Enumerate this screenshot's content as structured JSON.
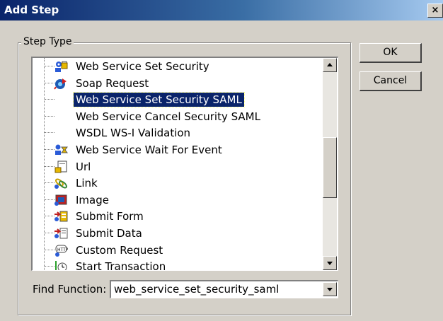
{
  "window": {
    "title": "Add Step",
    "close_glyph": "×"
  },
  "group": {
    "legend": "Step Type"
  },
  "step_list": {
    "items": [
      {
        "label": "Web Service Set Security",
        "icon": "web-service-security-icon",
        "selected": false
      },
      {
        "label": "Soap Request",
        "icon": "soap-request-icon",
        "selected": false
      },
      {
        "label": "Web Service Set Security SAML",
        "icon": "",
        "selected": true
      },
      {
        "label": "Web Service Cancel Security SAML",
        "icon": "",
        "selected": false
      },
      {
        "label": "WSDL WS-I Validation",
        "icon": "",
        "selected": false
      },
      {
        "label": "Web Service Wait For Event",
        "icon": "wait-for-event-icon",
        "selected": false
      },
      {
        "label": "Url",
        "icon": "url-icon",
        "selected": false
      },
      {
        "label": "Link",
        "icon": "link-icon",
        "selected": false
      },
      {
        "label": "Image",
        "icon": "image-icon",
        "selected": false
      },
      {
        "label": "Submit Form",
        "icon": "submit-form-icon",
        "selected": false
      },
      {
        "label": "Submit Data",
        "icon": "submit-data-icon",
        "selected": false
      },
      {
        "label": "Custom Request",
        "icon": "custom-request-icon",
        "selected": false
      },
      {
        "label": "Start Transaction",
        "icon": "start-transaction-icon",
        "selected": false
      }
    ],
    "scroll_position": 0.4
  },
  "find": {
    "label": "Find Function:",
    "value": "web_service_set_security_saml"
  },
  "buttons": {
    "ok": "OK",
    "cancel": "Cancel"
  },
  "colors": {
    "selection": "#0a246a",
    "face": "#d4d0c8"
  }
}
